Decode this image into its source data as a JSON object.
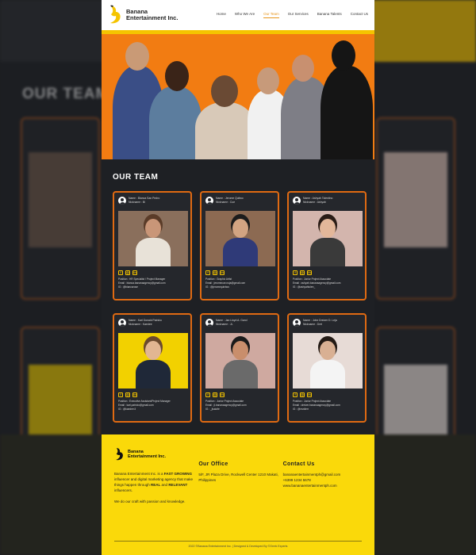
{
  "brand": {
    "name_line1": "Banana",
    "name_line2": "Entertainment Inc."
  },
  "nav": [
    {
      "label": "Home",
      "active": false
    },
    {
      "label": "Who We Are",
      "active": false
    },
    {
      "label": "Our Team",
      "active": true
    },
    {
      "label": "Our Services",
      "active": false
    },
    {
      "label": "Banana Talents",
      "active": false
    },
    {
      "label": "Contact Us",
      "active": false
    }
  ],
  "team": {
    "title": "OUR TEAM",
    "members": [
      {
        "name": "Name : Bianca San Pedro",
        "nickname": "Nickname : Bi",
        "position": "Position : HR Specialist / Project Manager",
        "email": "Email : bianca.bananaagency@gmail.com",
        "ig": "IG : @biancarose",
        "photo_bg": "#8a6f5c",
        "skin": "#c99678",
        "hair": "#5a3b28",
        "shirt": "#e8e2d8"
      },
      {
        "name": "Name : Jerome Quitwo",
        "nickname": "Nickname : Cue",
        "position": "Position : Graphic Artist",
        "email": "Email : jeromecue.nuja@gmail.com",
        "ig": "IG : @jeromequintwo",
        "photo_bg": "#8c6a52",
        "skin": "#d2a482",
        "hair": "#1c1c1c",
        "shirt": "#2f3a78"
      },
      {
        "name": "Name : Ashyah Tolentino",
        "nickname": "Nickname : Ashyah",
        "position": "Position : Junior Project Associate",
        "email": "Email : ashyah.bananaagency@gmail.com",
        "ig": "IG : @ashyahtolen_",
        "photo_bg": "#d3b5ad",
        "skin": "#e3b79a",
        "hair": "#2a1c16",
        "shirt": "#3a3a3a"
      },
      {
        "name": "Name : Karl Donald Patricio",
        "nickname": "Nickname : Kaedee",
        "position": "Position : Executive Assistant/Project Manager",
        "email": "Email : karl.patricio@gmail.com",
        "ig": "IG : @kaedee.ll",
        "photo_bg": "#f2d100",
        "skin": "#e2b692",
        "hair": "#6b4a2e",
        "shirt": "#1f2838"
      },
      {
        "name": "Name : Jan Lloyd A. Garol",
        "nickname": "Nickname : JL",
        "position": "Position : Junior Project Associate",
        "email": "Email : jl.bananaagency@gmail.com",
        "ig": "IG : _jlsaiofe",
        "photo_bg": "#cfa9a0",
        "skin": "#c98e6c",
        "hair": "#1a1a1a",
        "shirt": "#6a6a6a"
      },
      {
        "name": "Name : John Dreizer D. Leja",
        "nickname": "Nickname : Drei",
        "position": "Position : Junior Project Associate",
        "email": "Email : dreizer.bananaagency@gmail.com",
        "ig": "IG : @rezdierr",
        "photo_bg": "#e7dbd6",
        "skin": "#d9b093",
        "hair": "#231a15",
        "shirt": "#f4f4f4"
      }
    ]
  },
  "footer": {
    "logo_line1": "Banana",
    "logo_line2": "Entertainment Inc.",
    "about_pre": "Banana Entertainment Inc. is a ",
    "about_bold1": "FAST GROWING",
    "about_mid": " influencer and digital marketing agency that make things happen through ",
    "about_bold2": "REAL",
    "about_mid2": " and ",
    "about_bold3": "RELEVANT",
    "about_post": " influencers.",
    "tagline": "We do our craft with passion and knowledge.",
    "office_heading": "Our Office",
    "office_address": "5/F, JR Plaza Drive, Rockwell Center 1210 Makati, Philippines",
    "contact_heading": "Contact Us",
    "contact_email": "bananaentertainmentph@gmail.com",
    "contact_phone": "+6399 1234 5678",
    "contact_web": "www.bananaentertainmentph.com",
    "copyright": "2022 ©Banana Entertainment Inc. | Designed & Developed By ©Orrek Experts"
  },
  "colors": {
    "accent_orange": "#f27c12",
    "card_border": "#e06a12",
    "footer_yellow": "#fad90a",
    "dark_bg": "#1e2024"
  }
}
